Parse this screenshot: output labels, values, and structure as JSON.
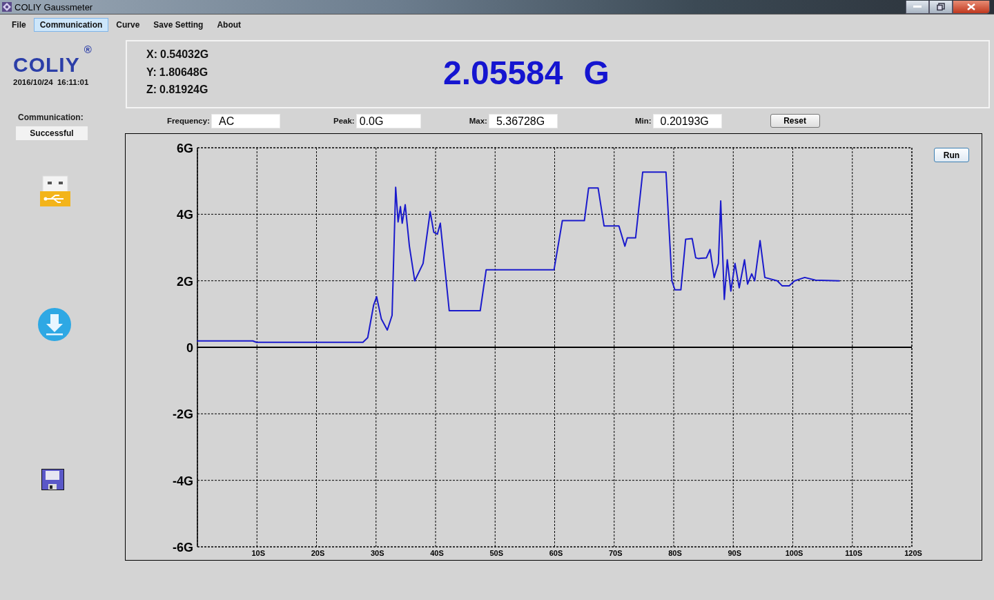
{
  "window": {
    "title": "COLIY Gaussmeter"
  },
  "menu": [
    {
      "label": "File",
      "selected": false
    },
    {
      "label": "Communication",
      "selected": true
    },
    {
      "label": "Curve",
      "selected": false
    },
    {
      "label": "Save Setting",
      "selected": false
    },
    {
      "label": "About",
      "selected": false
    }
  ],
  "brand": {
    "logo": "COLIY",
    "registered": "®",
    "datetime": "2016/10/24  16:11:01"
  },
  "communication": {
    "label": "Communication:",
    "status": "Successful"
  },
  "readout": {
    "axes": [
      {
        "label": "X:",
        "value": "0.54032G"
      },
      {
        "label": "Y:",
        "value": "1.80648G"
      },
      {
        "label": "Z:",
        "value": "0.81924G"
      }
    ],
    "total": "2.05584",
    "unit": "G"
  },
  "stats": [
    {
      "label": "Frequency:",
      "value": "AC"
    },
    {
      "label": "Peak:",
      "value": "0.0G"
    },
    {
      "label": "Max:",
      "value": "5.36728G"
    },
    {
      "label": "Min:",
      "value": "0.20193G"
    }
  ],
  "buttons": {
    "reset": "Reset",
    "run": "Run"
  },
  "chart": {
    "chart_data": {
      "type": "line",
      "grid": true,
      "xlim": [
        0,
        120
      ],
      "ylim": [
        -6,
        6
      ],
      "xticks": [
        {
          "value": 10,
          "label": "10S"
        },
        {
          "value": 20,
          "label": "20S"
        },
        {
          "value": 30,
          "label": "30S"
        },
        {
          "value": 40,
          "label": "40S"
        },
        {
          "value": 50,
          "label": "50S"
        },
        {
          "value": 60,
          "label": "60S"
        },
        {
          "value": 70,
          "label": "70S"
        },
        {
          "value": 80,
          "label": "80S"
        },
        {
          "value": 90,
          "label": "90S"
        },
        {
          "value": 100,
          "label": "100S"
        },
        {
          "value": 110,
          "label": "110S"
        },
        {
          "value": 120,
          "label": "120S"
        }
      ],
      "yticks": [
        {
          "value": 6,
          "label": "6G"
        },
        {
          "value": 4,
          "label": "4G"
        },
        {
          "value": 2,
          "label": "2G"
        },
        {
          "value": 0,
          "label": "0"
        },
        {
          "value": -2,
          "label": "-2G"
        },
        {
          "value": -4,
          "label": "-4G"
        },
        {
          "value": -6,
          "label": "-6G"
        }
      ],
      "x": [
        0,
        9.3,
        9.9,
        27.8,
        28.6,
        29.6,
        30.1,
        30.9,
        31.9,
        32.7,
        33.3,
        33.7,
        34.1,
        34.4,
        34.9,
        35.6,
        36.5,
        37.9,
        39.1,
        39.7,
        40.3,
        40.8,
        42.3,
        47.5,
        48.5,
        59.9,
        61.3,
        65.0,
        65.7,
        67.3,
        68.3,
        70.8,
        71.8,
        72.2,
        73.6,
        74.8,
        78.7,
        79.7,
        80.2,
        81.2,
        82.0,
        83.1,
        83.7,
        84.1,
        85.5,
        86.1,
        86.8,
        87.5,
        87.9,
        88.5,
        89.0,
        89.6,
        90.3,
        91.0,
        91.9,
        92.4,
        93.1,
        93.6,
        94.5,
        95.3,
        97.4,
        98.2,
        99.4,
        100.3,
        102.0,
        103.8,
        107.8
      ],
      "series": [
        {
          "color": "#1a1acc",
          "values": [
            0.19,
            0.19,
            0.15,
            0.15,
            0.29,
            1.27,
            1.52,
            0.85,
            0.52,
            0.96,
            4.81,
            3.77,
            4.23,
            3.73,
            4.29,
            3.04,
            2.0,
            2.52,
            4.08,
            3.46,
            3.4,
            3.73,
            1.1,
            1.1,
            2.33,
            2.33,
            3.81,
            3.81,
            4.79,
            4.79,
            3.65,
            3.65,
            3.04,
            3.29,
            3.29,
            5.27,
            5.27,
            2.0,
            1.73,
            1.73,
            3.25,
            3.27,
            2.69,
            2.67,
            2.69,
            2.94,
            2.1,
            2.52,
            4.4,
            1.44,
            2.63,
            1.69,
            2.52,
            1.79,
            2.63,
            1.9,
            2.21,
            2.0,
            3.21,
            2.1,
            2.0,
            1.85,
            1.85,
            2.0,
            2.1,
            2.02,
            2.0
          ]
        }
      ]
    }
  }
}
